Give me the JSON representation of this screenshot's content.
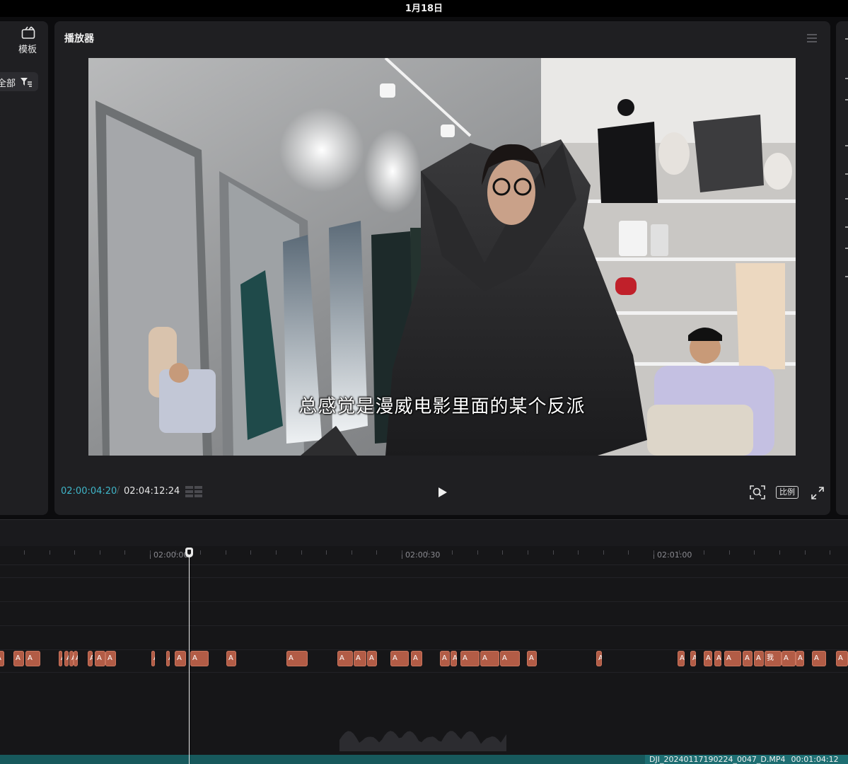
{
  "system": {
    "date": "1月18日"
  },
  "left_panel": {
    "template_label": "模板",
    "filter_label": "全部"
  },
  "player": {
    "title": "播放器",
    "subtitle": "总感觉是漫威电影里面的某个反派",
    "current_time": "02:00:04:20",
    "total_time": "02:04:12:24",
    "ratio_label": "比例"
  },
  "timeline": {
    "ticks": [
      "02:00:00",
      "02:00:30",
      "02:01:00"
    ],
    "playhead_time": "02:00:04:20",
    "text_clips": [
      {
        "label": "A"
      },
      {
        "label": "A"
      },
      {
        "label": "A"
      },
      {
        "label": "A"
      },
      {
        "label": "A"
      },
      {
        "label": "A"
      },
      {
        "label": "A"
      },
      {
        "label": "A"
      },
      {
        "label": "A"
      },
      {
        "label": "A"
      },
      {
        "label": "A"
      },
      {
        "label": "A"
      },
      {
        "label": "A"
      },
      {
        "label": "A"
      },
      {
        "label": "A"
      },
      {
        "label": "A"
      },
      {
        "label": "A"
      },
      {
        "label": "A"
      },
      {
        "label": "A"
      },
      {
        "label": "A"
      },
      {
        "label": "A"
      },
      {
        "label": "A"
      },
      {
        "label": "A"
      },
      {
        "label": "A"
      },
      {
        "label": "A"
      },
      {
        "label": "A"
      },
      {
        "label": "A"
      },
      {
        "label": "A"
      },
      {
        "label": "A"
      },
      {
        "label": "A"
      },
      {
        "label": "A"
      },
      {
        "label": "A"
      },
      {
        "label": "A"
      },
      {
        "label": "A"
      },
      {
        "label": "A"
      },
      {
        "label": "我"
      },
      {
        "label": "A"
      },
      {
        "label": "A"
      },
      {
        "label": "A"
      }
    ],
    "video_clip": {
      "name": "DJI_20240117190224_0047_D.MP4",
      "duration": "00:01:04:12"
    }
  },
  "colors": {
    "accent_time": "#3fb6c9",
    "text_clip": "#b25c46",
    "video_clip": "#1d6e72"
  }
}
